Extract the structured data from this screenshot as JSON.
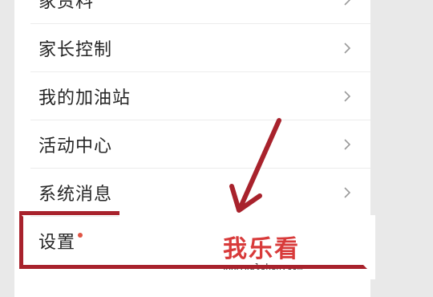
{
  "menu": {
    "items": [
      {
        "label": "家资料"
      },
      {
        "label": "家长控制"
      },
      {
        "label": "我的加油站"
      },
      {
        "label": "活动中心"
      },
      {
        "label": "系统消息"
      },
      {
        "label": "设置"
      }
    ]
  },
  "watermark": {
    "title": "我乐看",
    "url": "www.waleken.com"
  },
  "colors": {
    "highlight": "#a8222c",
    "watermark_red": "#d83a3a",
    "notification_dot": "#e05545"
  }
}
